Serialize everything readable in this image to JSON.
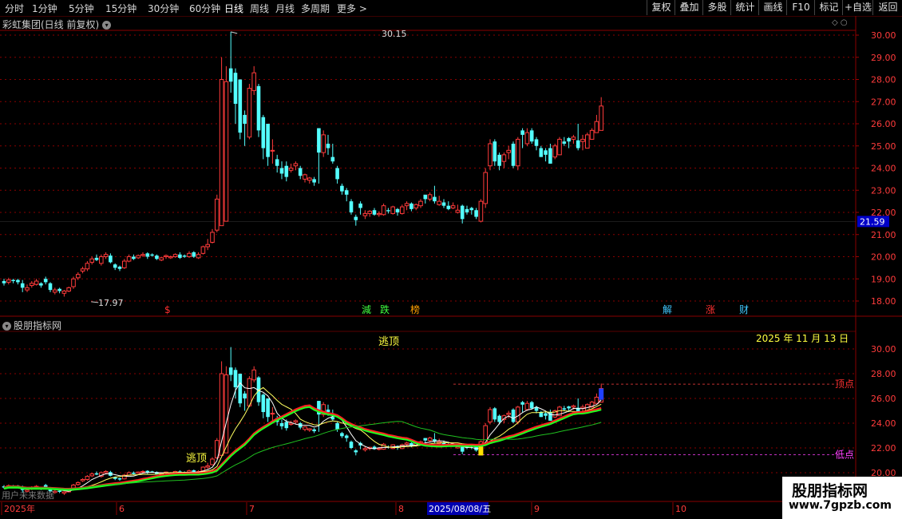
{
  "toolbar": {
    "periods": [
      "分时",
      "1分钟",
      "5分钟",
      "15分钟",
      "30分钟",
      "60分钟",
      "日线",
      "周线",
      "月线",
      "多周期",
      "更多 >"
    ],
    "active_period": "日线",
    "buttons": [
      "复权",
      "叠加",
      "多股",
      "统计",
      "画线",
      "F10",
      "标记",
      "+自选",
      "返回"
    ]
  },
  "main_panel": {
    "title": "彩虹集团(日线 前复权)",
    "price_ticks": [
      "30.00",
      "29.00",
      "28.00",
      "27.00",
      "26.00",
      "25.00",
      "24.00",
      "23.00",
      "22.00",
      "21.00",
      "20.00",
      "19.00",
      "18.00"
    ],
    "current_price_label": "21.59",
    "high_label": "30.15",
    "low_label": "17.97",
    "signals": [
      {
        "text": "$",
        "color": "#ff3030"
      },
      {
        "text": "減",
        "color": "#40ff40"
      },
      {
        "text": "跌",
        "color": "#40ff40"
      },
      {
        "text": "榜",
        "color": "#ffa000"
      },
      {
        "text": "解",
        "color": "#40c8ff"
      },
      {
        "text": "涨",
        "color": "#ff3030"
      },
      {
        "text": "财",
        "color": "#40c8ff"
      }
    ]
  },
  "indicator_panel": {
    "title": "股朋指标网",
    "date": "2025 年 11 月 13 日",
    "price_ticks": [
      "30.00",
      "28.00",
      "26.00",
      "24.00",
      "22.00",
      "20.00"
    ],
    "escape_top_labels": [
      "逃顶",
      "逃顶"
    ],
    "top_point_label": "顶点",
    "low_point_label": "低点",
    "overlay_text": "用户未来数据"
  },
  "date_axis": {
    "labels": [
      "2025年",
      "6",
      "7",
      "8",
      "9",
      "10"
    ],
    "cursor_date": "2025/08/08/五"
  },
  "watermark": {
    "title": "股朋指标网",
    "url": "www.7gpzb.com"
  },
  "colors": {
    "up": "#ff3b3b",
    "down": "#54ffff",
    "grid": "#8a0000",
    "axis_text": "#ff3b3b",
    "bg": "#000000"
  },
  "chart_data": {
    "type": "candlestick",
    "x": [
      "2025-05-06",
      "2025-05-07",
      "2025-05-08",
      "2025-05-09",
      "2025-05-12",
      "2025-05-13",
      "2025-05-14",
      "2025-05-15",
      "2025-05-16",
      "2025-05-19",
      "2025-05-20",
      "2025-05-21",
      "2025-05-22",
      "2025-05-23",
      "2025-05-26",
      "2025-05-27",
      "2025-05-28",
      "2025-05-29",
      "2025-05-30",
      "2025-06-03",
      "2025-06-04",
      "2025-06-05",
      "2025-06-06",
      "2025-06-09",
      "2025-06-10",
      "2025-06-11",
      "2025-06-12",
      "2025-06-13",
      "2025-06-16",
      "2025-06-17",
      "2025-06-18",
      "2025-06-19",
      "2025-06-20",
      "2025-06-23",
      "2025-06-24",
      "2025-06-25",
      "2025-06-26",
      "2025-06-27",
      "2025-06-30",
      "2025-07-01",
      "2025-07-02",
      "2025-07-03",
      "2025-07-04",
      "2025-07-07",
      "2025-07-08",
      "2025-07-09",
      "2025-07-10",
      "2025-07-11",
      "2025-07-14",
      "2025-07-15",
      "2025-07-16",
      "2025-07-17",
      "2025-07-18",
      "2025-07-21",
      "2025-07-22",
      "2025-07-23",
      "2025-07-24",
      "2025-07-25",
      "2025-07-28",
      "2025-07-29",
      "2025-07-30",
      "2025-07-31",
      "2025-08-01",
      "2025-08-04",
      "2025-08-05",
      "2025-08-06",
      "2025-08-07",
      "2025-08-08",
      "2025-08-11",
      "2025-08-12",
      "2025-08-13",
      "2025-08-14",
      "2025-08-15",
      "2025-08-18",
      "2025-08-19",
      "2025-08-20",
      "2025-08-21",
      "2025-08-22",
      "2025-08-25",
      "2025-08-26",
      "2025-08-27",
      "2025-08-28",
      "2025-08-29",
      "2025-09-01",
      "2025-09-02",
      "2025-09-03",
      "2025-09-04",
      "2025-09-05",
      "2025-09-08",
      "2025-09-09",
      "2025-09-10",
      "2025-09-11",
      "2025-09-12",
      "2025-09-15",
      "2025-09-16",
      "2025-09-17",
      "2025-09-18",
      "2025-09-19",
      "2025-09-22",
      "2025-09-23",
      "2025-09-24",
      "2025-09-25",
      "2025-09-26",
      "2025-09-29",
      "2025-09-30",
      "2025-10-09",
      "2025-10-10",
      "2025-10-13",
      "2025-10-14",
      "2025-10-15",
      "2025-10-16",
      "2025-10-17",
      "2025-10-20",
      "2025-10-21",
      "2025-10-22",
      "2025-10-23",
      "2025-10-24",
      "2025-10-27",
      "2025-10-28",
      "2025-10-29",
      "2025-10-30",
      "2025-10-31",
      "2025-11-03",
      "2025-11-04",
      "2025-11-05",
      "2025-11-06",
      "2025-11-07",
      "2025-11-10",
      "2025-11-11",
      "2025-11-12",
      "2025-11-13"
    ],
    "open": [
      18.9,
      18.85,
      18.95,
      18.95,
      18.8,
      18.5,
      18.7,
      18.75,
      18.8,
      19.0,
      18.8,
      18.4,
      18.55,
      18.35,
      18.45,
      18.65,
      19.05,
      19.35,
      19.45,
      19.75,
      19.95,
      19.7,
      20.0,
      20.05,
      19.65,
      19.55,
      19.5,
      19.8,
      20.0,
      19.95,
      20.05,
      20.15,
      20.1,
      20.05,
      19.85,
      20.0,
      19.95,
      20.0,
      20.1,
      20.05,
      20.0,
      20.2,
      19.95,
      20.15,
      20.45,
      20.65,
      21.2,
      21.4,
      21.6,
      28.5,
      28.3,
      28.0,
      26.4,
      25.4,
      27.5,
      27.7,
      26.3,
      26.0,
      24.8,
      24.4,
      24.0,
      24.1,
      23.9,
      24.1,
      24.0,
      23.5,
      23.45,
      23.5,
      25.8,
      24.7,
      25.1,
      24.5,
      24.0,
      23.2,
      23.0,
      22.5,
      21.8,
      22.4,
      21.85,
      21.95,
      22.1,
      21.9,
      21.9,
      22.1,
      21.95,
      22.15,
      21.95,
      22.3,
      22.4,
      22.2,
      22.3,
      22.8,
      22.6,
      22.7,
      22.35,
      22.45,
      22.3,
      22.2,
      22.0,
      22.3,
      22.15,
      22.2,
      22.1,
      21.6,
      22.4,
      24.1,
      25.2,
      24.6,
      24.3,
      24.7,
      25.1,
      24.1,
      25.7,
      25.1,
      25.7,
      25.3,
      24.9,
      24.8,
      24.9,
      24.5,
      24.6,
      25.2,
      25.35,
      25.3,
      25.25,
      25.2,
      24.9,
      25.3,
      25.6,
      25.7,
      26.2
    ],
    "close": [
      18.8,
      18.95,
      18.9,
      18.85,
      18.6,
      18.6,
      18.8,
      18.9,
      18.7,
      18.85,
      18.5,
      18.5,
      18.45,
      18.45,
      18.6,
      19.0,
      19.2,
      19.45,
      19.7,
      19.9,
      19.85,
      20.0,
      20.1,
      19.75,
      19.5,
      19.45,
      19.8,
      20.0,
      19.9,
      20.05,
      20.1,
      20.0,
      20.05,
      19.9,
      19.95,
      20.05,
      20.0,
      20.1,
      19.95,
      20.0,
      20.15,
      20.0,
      20.1,
      20.45,
      20.55,
      21.1,
      22.6,
      28.0,
      27.9,
      27.9,
      26.9,
      25.6,
      26.0,
      27.6,
      28.3,
      25.7,
      24.9,
      24.5,
      24.8,
      24.1,
      23.75,
      23.6,
      24.0,
      24.2,
      23.65,
      23.7,
      23.55,
      23.35,
      24.7,
      25.5,
      24.9,
      24.3,
      23.5,
      22.95,
      22.8,
      22.0,
      21.65,
      22.2,
      21.95,
      22.05,
      21.9,
      21.95,
      22.3,
      22.05,
      22.25,
      22.0,
      22.25,
      22.4,
      22.15,
      22.35,
      22.5,
      22.6,
      22.8,
      22.5,
      22.5,
      22.3,
      22.15,
      22.3,
      22.1,
      21.7,
      22.0,
      22.1,
      21.8,
      22.5,
      23.8,
      25.1,
      24.3,
      24.1,
      24.6,
      24.8,
      24.1,
      25.3,
      25.5,
      25.6,
      25.2,
      25.0,
      24.5,
      24.6,
      24.2,
      25.0,
      25.3,
      25.1,
      25.2,
      25.4,
      24.9,
      25.3,
      25.5,
      25.7,
      26.1,
      26.8
    ],
    "high": [
      19.0,
      19.05,
      19.0,
      19.0,
      18.95,
      18.75,
      18.9,
      19.0,
      18.85,
      19.1,
      18.85,
      18.6,
      18.6,
      18.5,
      18.65,
      19.1,
      19.3,
      19.55,
      19.8,
      20.0,
      20.1,
      20.1,
      20.2,
      20.15,
      19.7,
      19.6,
      19.9,
      20.1,
      20.1,
      20.1,
      20.2,
      20.2,
      20.15,
      20.1,
      20.0,
      20.1,
      20.05,
      20.15,
      20.2,
      20.1,
      20.25,
      20.25,
      20.2,
      20.5,
      20.8,
      21.25,
      22.8,
      29.0,
      28.6,
      30.15,
      28.5,
      28.0,
      26.6,
      27.8,
      28.6,
      27.8,
      26.4,
      26.0,
      25.3,
      24.6,
      24.3,
      24.3,
      24.2,
      24.3,
      24.1,
      23.75,
      23.6,
      23.6,
      25.8,
      25.7,
      25.5,
      25.1,
      24.1,
      23.3,
      23.1,
      22.6,
      21.9,
      22.5,
      22.1,
      22.1,
      22.2,
      22.05,
      22.4,
      22.2,
      22.3,
      22.2,
      22.35,
      22.5,
      22.45,
      22.4,
      22.6,
      22.7,
      22.9,
      23.2,
      22.75,
      22.6,
      22.5,
      22.45,
      22.35,
      22.35,
      22.3,
      22.25,
      22.2,
      22.6,
      24.0,
      25.3,
      25.3,
      24.7,
      24.7,
      25.0,
      25.2,
      25.4,
      25.8,
      25.8,
      25.8,
      25.4,
      25.0,
      24.9,
      25.1,
      25.1,
      25.4,
      25.4,
      25.4,
      25.5,
      26.0,
      25.5,
      25.6,
      25.8,
      26.4,
      27.2
    ],
    "low": [
      18.7,
      18.75,
      18.8,
      18.75,
      18.4,
      18.4,
      18.6,
      18.7,
      18.6,
      18.75,
      18.4,
      18.3,
      18.35,
      18.2,
      18.4,
      18.55,
      18.95,
      19.25,
      19.35,
      19.65,
      19.8,
      19.6,
      19.9,
      19.7,
      19.4,
      19.35,
      19.45,
      19.75,
      19.85,
      19.9,
      20.0,
      19.9,
      20.0,
      19.85,
      19.8,
      19.9,
      19.9,
      19.95,
      19.9,
      19.95,
      19.95,
      19.95,
      19.9,
      20.1,
      20.3,
      20.6,
      21.1,
      21.4,
      26.9,
      27.4,
      26.0,
      25.3,
      25.0,
      25.3,
      27.3,
      25.4,
      24.4,
      24.1,
      24.2,
      23.8,
      23.5,
      23.4,
      23.8,
      23.9,
      23.5,
      23.35,
      23.3,
      23.2,
      23.3,
      24.5,
      24.6,
      24.2,
      23.3,
      22.8,
      22.5,
      21.9,
      21.4,
      21.9,
      21.7,
      21.8,
      21.85,
      21.8,
      21.85,
      21.95,
      21.9,
      21.85,
      21.9,
      22.1,
      22.05,
      22.1,
      22.2,
      22.4,
      22.5,
      22.4,
      22.3,
      22.2,
      22.1,
      22.15,
      21.95,
      21.5,
      21.9,
      21.9,
      21.7,
      21.55,
      22.2,
      23.9,
      24.1,
      23.9,
      24.0,
      24.4,
      24.0,
      23.9,
      24.9,
      25.0,
      25.1,
      24.8,
      24.5,
      24.3,
      24.2,
      24.4,
      24.9,
      25.0,
      24.9,
      25.1,
      24.8,
      24.8,
      25.1,
      25.4,
      25.6,
      26.0
    ]
  }
}
